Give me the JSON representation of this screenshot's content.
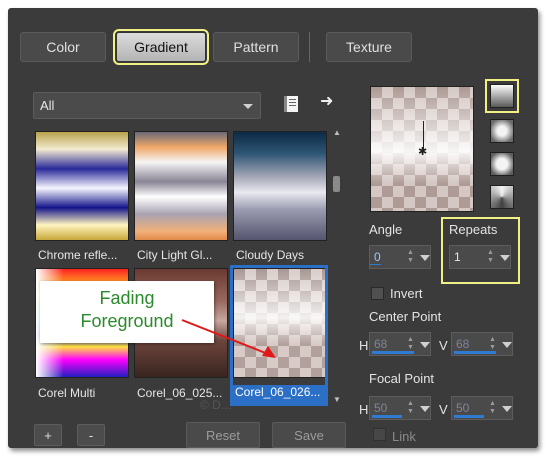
{
  "tabs": {
    "color": "Color",
    "gradient": "Gradient",
    "pattern": "Pattern",
    "texture": "Texture"
  },
  "library": {
    "category": "All",
    "book_icon": "book-icon",
    "arrow_icon": "arrow-right-icon",
    "items": [
      {
        "label": "Chrome refle..."
      },
      {
        "label": "City Light Gl..."
      },
      {
        "label": "Cloudy Days"
      },
      {
        "label": "Corel Multi"
      },
      {
        "label": "Corel_06_025..."
      },
      {
        "label": "Corel_06_026..."
      }
    ],
    "selected_index": 5
  },
  "callout": {
    "line1": "Fading",
    "line2": "Foreground",
    "color": "#2b8a2b",
    "arrow_color": "#e01818"
  },
  "settings": {
    "angle_label": "Angle",
    "angle_value": "0",
    "repeats_label": "Repeats",
    "repeats_value": "1",
    "invert_label": "Invert",
    "center_point_label": "Center Point",
    "center_h_label": "H",
    "center_h_value": "68",
    "center_v_label": "V",
    "center_v_value": "68",
    "focal_point_label": "Focal Point",
    "focal_h_label": "H",
    "focal_h_value": "50",
    "focal_v_label": "V",
    "focal_v_value": "50",
    "link_label": "Link"
  },
  "buttons": {
    "add": "+",
    "remove": "-",
    "reset": "Reset",
    "save": "Save"
  },
  "watermark": "© D...",
  "colors": {
    "accent": "#2b6fc6",
    "highlight": "#f0f084",
    "panel": "#3b3b3b"
  }
}
